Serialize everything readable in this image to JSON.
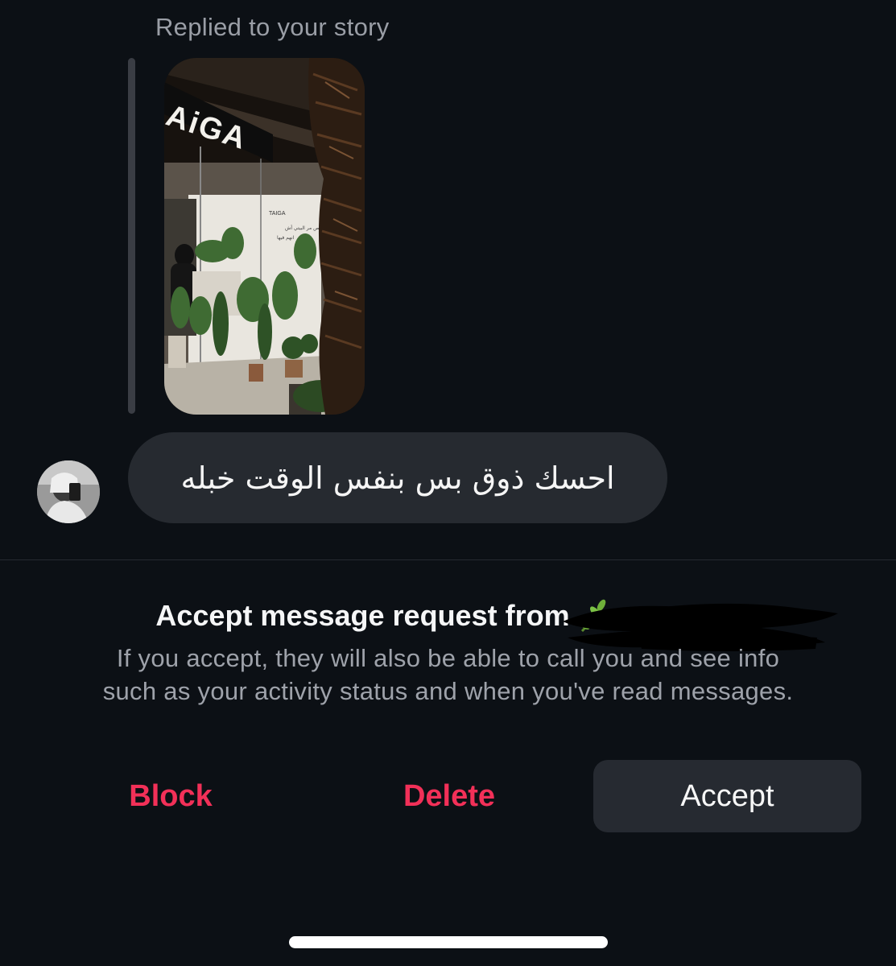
{
  "story_reply": {
    "label": "Replied to your story",
    "thumbnail": {
      "sign_text": "AiGA",
      "inner_brand": "TAIGA",
      "poster_line_1": "أي شخص مر البيتي أش",
      "poster_line_2": "انهم فيها"
    }
  },
  "message": {
    "text": "احسك ذوق بس بنفس الوقت خبله"
  },
  "request": {
    "title": "Accept message request from",
    "sender_icon": "sprig-emoji-icon",
    "sender_name_redacted": true,
    "body_line_1": "If you accept, they will also be able to call you and see info",
    "body_line_2": "such as your activity status and when you've read messages."
  },
  "actions": {
    "block_label": "Block",
    "delete_label": "Delete",
    "accept_label": "Accept"
  },
  "colors": {
    "background": "#0c1015",
    "bubble": "#262a30",
    "destructive": "#f23058",
    "accept_bg": "#262a31",
    "muted_text": "#9ea2aa"
  }
}
